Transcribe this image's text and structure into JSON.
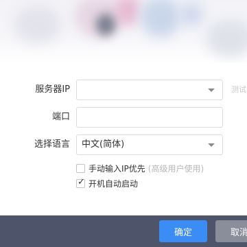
{
  "form": {
    "server_ip": {
      "label": "服务器IP",
      "value": "",
      "test_label": "测试"
    },
    "port": {
      "label": "端口",
      "value": ""
    },
    "language": {
      "label": "选择语言",
      "value": "中文(简体)"
    }
  },
  "options": {
    "manual_ip": {
      "label": "手动输入IP优先",
      "hint": "(高级用户使用)",
      "checked": false
    },
    "autostart": {
      "label": "开机自动启动",
      "checked": true
    }
  },
  "footer": {
    "ok_label": "确定",
    "cancel_label": "取消"
  },
  "icons": {
    "dropdown": "chevron-down-icon",
    "check": "checkmark-icon"
  }
}
